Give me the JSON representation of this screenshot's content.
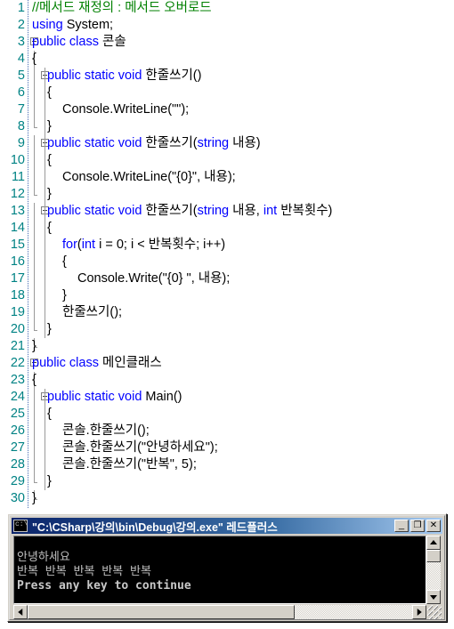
{
  "editor": {
    "name": "code-editor",
    "language": "csharp",
    "colors": {
      "background": "#ffffff",
      "text": "#000000",
      "keyword": "#0000ff",
      "comment": "#008000",
      "line_number": "#008284",
      "fold_line": "#9a9a9a"
    },
    "lines": [
      {
        "n": "1",
        "indent": 0,
        "fold": "none",
        "tokens": [
          {
            "t": "//메서드 재정의 : 메서드 오버로드",
            "c": "cmt"
          }
        ]
      },
      {
        "n": "2",
        "indent": 0,
        "fold": "none",
        "tokens": [
          {
            "t": "using",
            "c": "kw"
          },
          {
            "t": " System;",
            "c": ""
          }
        ]
      },
      {
        "n": "3",
        "indent": 0,
        "fold": "box",
        "tokens": [
          {
            "t": "public class",
            "c": "kw"
          },
          {
            "t": " 콘솔",
            "c": ""
          }
        ]
      },
      {
        "n": "4",
        "indent": 0,
        "fold": "line",
        "tokens": [
          {
            "t": "{",
            "c": ""
          }
        ]
      },
      {
        "n": "5",
        "indent": 1,
        "fold": "box-line",
        "tokens": [
          {
            "t": "public static void",
            "c": "kw"
          },
          {
            "t": " 한줄쓰기()",
            "c": ""
          }
        ]
      },
      {
        "n": "6",
        "indent": 1,
        "fold": "line2",
        "tokens": [
          {
            "t": "{",
            "c": ""
          }
        ]
      },
      {
        "n": "7",
        "indent": 2,
        "fold": "line2",
        "tokens": [
          {
            "t": "Console.WriteLine(\"\");",
            "c": ""
          }
        ]
      },
      {
        "n": "8",
        "indent": 1,
        "fold": "end2",
        "tokens": [
          {
            "t": "}",
            "c": ""
          }
        ]
      },
      {
        "n": "9",
        "indent": 1,
        "fold": "box-line",
        "tokens": [
          {
            "t": "public static void",
            "c": "kw"
          },
          {
            "t": " 한줄쓰기(",
            "c": ""
          },
          {
            "t": "string",
            "c": "kw"
          },
          {
            "t": " 내용)",
            "c": ""
          }
        ]
      },
      {
        "n": "10",
        "indent": 1,
        "fold": "line2",
        "tokens": [
          {
            "t": "{",
            "c": ""
          }
        ]
      },
      {
        "n": "11",
        "indent": 2,
        "fold": "line2",
        "tokens": [
          {
            "t": "Console.WriteLine(\"{0}\", 내용);",
            "c": ""
          }
        ]
      },
      {
        "n": "12",
        "indent": 1,
        "fold": "end2",
        "tokens": [
          {
            "t": "}",
            "c": ""
          }
        ]
      },
      {
        "n": "13",
        "indent": 1,
        "fold": "box-line",
        "tokens": [
          {
            "t": "public static void",
            "c": "kw"
          },
          {
            "t": " 한줄쓰기(",
            "c": ""
          },
          {
            "t": "string",
            "c": "kw"
          },
          {
            "t": " 내용, ",
            "c": ""
          },
          {
            "t": "int",
            "c": "kw"
          },
          {
            "t": " 반복횟수)",
            "c": ""
          }
        ]
      },
      {
        "n": "14",
        "indent": 1,
        "fold": "line2",
        "tokens": [
          {
            "t": "{",
            "c": ""
          }
        ]
      },
      {
        "n": "15",
        "indent": 2,
        "fold": "line2",
        "tokens": [
          {
            "t": "for",
            "c": "kw"
          },
          {
            "t": "(",
            "c": ""
          },
          {
            "t": "int",
            "c": "kw"
          },
          {
            "t": " i = 0; i < 반복횟수; i++)",
            "c": ""
          }
        ]
      },
      {
        "n": "16",
        "indent": 2,
        "fold": "line2",
        "tokens": [
          {
            "t": "{",
            "c": ""
          }
        ]
      },
      {
        "n": "17",
        "indent": 3,
        "fold": "line2",
        "tokens": [
          {
            "t": "Console.Write(\"{0} \", 내용);",
            "c": ""
          }
        ]
      },
      {
        "n": "18",
        "indent": 2,
        "fold": "line2",
        "tokens": [
          {
            "t": "}",
            "c": ""
          }
        ]
      },
      {
        "n": "19",
        "indent": 2,
        "fold": "line2",
        "tokens": [
          {
            "t": "한줄쓰기();",
            "c": ""
          }
        ]
      },
      {
        "n": "20",
        "indent": 1,
        "fold": "end2",
        "tokens": [
          {
            "t": "}",
            "c": ""
          }
        ]
      },
      {
        "n": "21",
        "indent": 0,
        "fold": "end",
        "tokens": [
          {
            "t": "}",
            "c": ""
          }
        ]
      },
      {
        "n": "22",
        "indent": 0,
        "fold": "box",
        "tokens": [
          {
            "t": "public class",
            "c": "kw"
          },
          {
            "t": " 메인클래스",
            "c": ""
          }
        ]
      },
      {
        "n": "23",
        "indent": 0,
        "fold": "line",
        "tokens": [
          {
            "t": "{",
            "c": ""
          }
        ]
      },
      {
        "n": "24",
        "indent": 1,
        "fold": "box-line",
        "tokens": [
          {
            "t": "public static void",
            "c": "kw"
          },
          {
            "t": " Main()",
            "c": ""
          }
        ]
      },
      {
        "n": "25",
        "indent": 1,
        "fold": "line2",
        "tokens": [
          {
            "t": "{",
            "c": ""
          }
        ]
      },
      {
        "n": "26",
        "indent": 2,
        "fold": "line2",
        "tokens": [
          {
            "t": "콘솔.한줄쓰기();",
            "c": ""
          }
        ]
      },
      {
        "n": "27",
        "indent": 2,
        "fold": "line2",
        "tokens": [
          {
            "t": "콘솔.한줄쓰기(\"안녕하세요\");",
            "c": ""
          }
        ]
      },
      {
        "n": "28",
        "indent": 2,
        "fold": "line2",
        "tokens": [
          {
            "t": "콘솔.한줄쓰기(\"반복\", 5);",
            "c": ""
          }
        ]
      },
      {
        "n": "29",
        "indent": 1,
        "fold": "end2",
        "tokens": [
          {
            "t": "}",
            "c": ""
          }
        ]
      },
      {
        "n": "30",
        "indent": 0,
        "fold": "end",
        "tokens": [
          {
            "t": "}",
            "c": ""
          }
        ]
      }
    ]
  },
  "console": {
    "title": "\"C:\\CSharp\\강의\\bin\\Debug\\강의.exe\" 레드플러스",
    "icon": "console-app-icon",
    "buttons": {
      "minimize": "_",
      "maximize": "❐",
      "close": "✕"
    },
    "output": [
      "",
      "안녕하세요",
      "반복 반복 반복 반복 반복",
      "Press any key to continue"
    ],
    "colors": {
      "screen_background": "#000000",
      "screen_text": "#c0c0c0",
      "titlebar_start": "#0a246a",
      "titlebar_end": "#a6caf0",
      "chrome": "#d4d0c8"
    }
  }
}
